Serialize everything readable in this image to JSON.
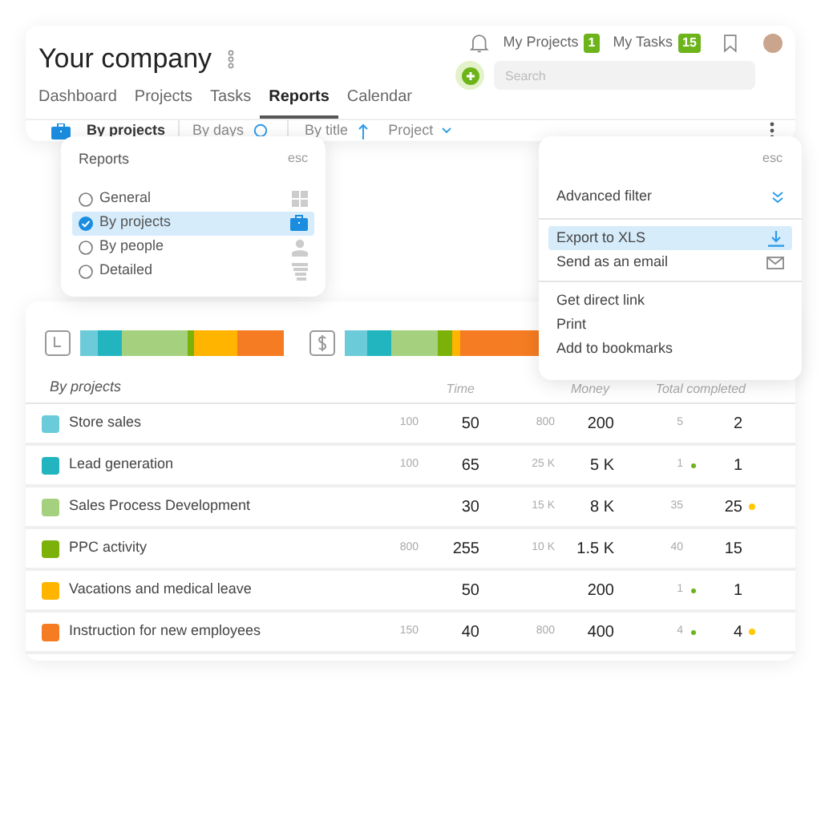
{
  "header": {
    "company": "Your company",
    "my_projects": {
      "label": "My Projects",
      "count": "1"
    },
    "my_tasks": {
      "label": "My Tasks",
      "count": "15"
    },
    "search": {
      "placeholder": "Search"
    }
  },
  "nav": [
    {
      "label": "Dashboard",
      "selected": false
    },
    {
      "label": "Projects",
      "selected": false
    },
    {
      "label": "Tasks",
      "selected": false
    },
    {
      "label": "Reports",
      "selected": true
    },
    {
      "label": "Calendar",
      "selected": false
    }
  ],
  "toolbar": {
    "view": "By projects",
    "period": "By days",
    "sort": "By title",
    "group": "Project"
  },
  "reports_menu": {
    "title": "Reports",
    "esc": "esc",
    "items": [
      {
        "label": "General",
        "selected": false
      },
      {
        "label": "By projects",
        "selected": true
      },
      {
        "label": "By people",
        "selected": false
      },
      {
        "label": "Detailed",
        "selected": false
      }
    ]
  },
  "actions_menu": {
    "esc": "esc",
    "groups": [
      [
        {
          "label": "Advanced filter",
          "selected": false
        }
      ],
      [
        {
          "label": "Export to XLS",
          "selected": true
        },
        {
          "label": "Send as an email",
          "selected": false
        }
      ],
      [
        {
          "label": "Get direct link",
          "selected": false
        },
        {
          "label": "Print",
          "selected": false
        },
        {
          "label": "Add to bookmarks",
          "selected": false
        }
      ]
    ]
  },
  "table": {
    "title": "By projects",
    "columns": [
      "Time",
      "Money",
      "Total completed"
    ],
    "rows": [
      {
        "color": "#6ccbd9",
        "name": "Store sales",
        "time_small": "100",
        "time": "50",
        "money_small": "800",
        "money": "200",
        "done_small": "5",
        "done_small_flag": false,
        "done": "2",
        "done_flag": false
      },
      {
        "color": "#22b5c0",
        "name": "Lead generation",
        "time_small": "100",
        "time": "65",
        "money_small": "25 K",
        "money": "5 K",
        "done_small": "1",
        "done_small_flag": true,
        "done": "1",
        "done_flag": false
      },
      {
        "color": "#a5d17f",
        "name": "Sales Process Development",
        "time": "30",
        "money_small": "15 K",
        "money": "8 K",
        "done_small": "35",
        "done_small_flag": false,
        "done": "25",
        "done_flag": true
      },
      {
        "color": "#7cb10a",
        "name": "PPC activity",
        "time_small": "800",
        "time": "255",
        "money_small": "10 K",
        "money": "1.5 K",
        "done_small": "40",
        "done_small_flag": false,
        "done": "15",
        "done_flag": false
      },
      {
        "color": "#ffb400",
        "name": "Vacations and medical leave",
        "time": "50",
        "money": "200",
        "done_small": "1",
        "done_small_flag": true,
        "done": "1",
        "done_flag": false
      },
      {
        "color": "#f57c22",
        "name": "Instruction for new employees",
        "time_small": "150",
        "time": "40",
        "money_small": "800",
        "money": "400",
        "done_small": "4",
        "done_small_flag": true,
        "done": "4",
        "done_flag": true
      }
    ]
  }
}
